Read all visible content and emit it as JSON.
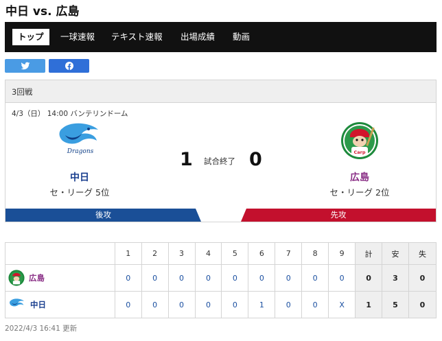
{
  "page": {
    "title": "中日 vs. 広島",
    "updated": "2022/4/3 16:41 更新"
  },
  "nav": {
    "items": [
      {
        "label": "トップ",
        "active": true
      },
      {
        "label": "一球速報"
      },
      {
        "label": "テキスト速報"
      },
      {
        "label": "出場成績"
      },
      {
        "label": "動画"
      }
    ]
  },
  "share": {
    "twitter_icon": "twitter-bird-icon",
    "facebook_icon": "facebook-f-icon"
  },
  "game": {
    "round": "3回戦",
    "info": "4/3（日） 14:00 バンテリンドーム",
    "status": "試合終了",
    "home": {
      "name": "中日",
      "rank": "セ・リーグ 5位",
      "score": "1",
      "side": "後攻",
      "color": "#1a4f97",
      "logo_text": "Dragons"
    },
    "away": {
      "name": "広島",
      "rank": "セ・リーグ 2位",
      "score": "0",
      "side": "先攻",
      "color": "#c3102d",
      "logo_text": "Carp"
    }
  },
  "linescore": {
    "headers": [
      "1",
      "2",
      "3",
      "4",
      "5",
      "6",
      "7",
      "8",
      "9",
      "計",
      "安",
      "失"
    ],
    "rows": [
      {
        "team": "広島",
        "cells": [
          "0",
          "0",
          "0",
          "0",
          "0",
          "0",
          "0",
          "0",
          "0",
          "0",
          "3",
          "0"
        ]
      },
      {
        "team": "中日",
        "cells": [
          "0",
          "0",
          "0",
          "0",
          "0",
          "1",
          "0",
          "0",
          "X",
          "1",
          "5",
          "0"
        ]
      }
    ]
  }
}
